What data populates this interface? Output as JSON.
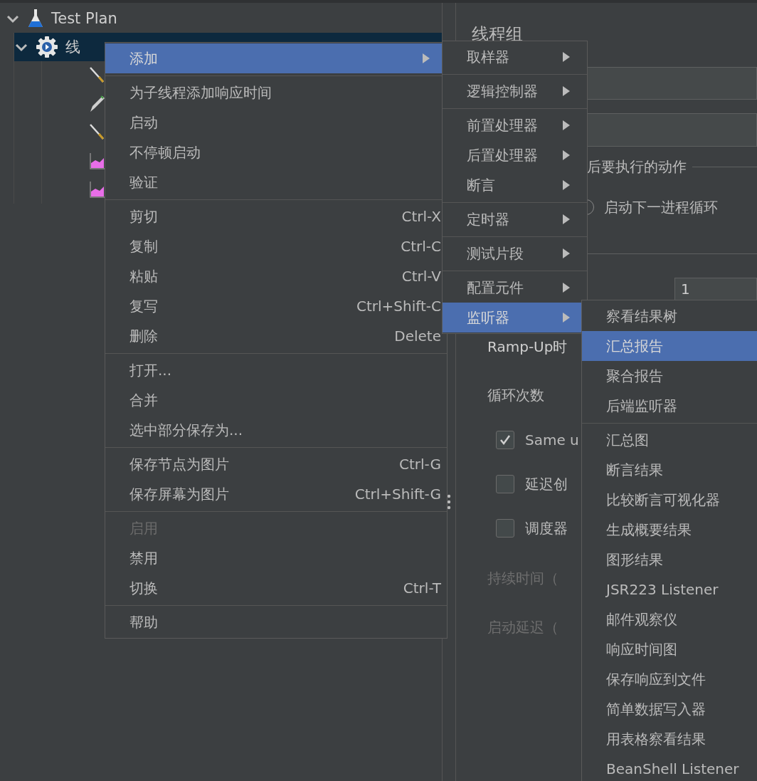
{
  "tree": [
    {
      "label": "Test Plan",
      "kind": "flask",
      "expanded": true,
      "selected": false,
      "children": [
        {
          "label": "线",
          "kind": "gear",
          "expanded": true,
          "selected": true,
          "children": [
            {
              "kind": "wand"
            },
            {
              "kind": "pencil"
            },
            {
              "kind": "wand"
            },
            {
              "kind": "chart"
            },
            {
              "kind": "chart"
            }
          ]
        }
      ]
    }
  ],
  "editor": {
    "title": "线程组",
    "group_label": "后要执行的动作",
    "radio": {
      "label": "启动下一进程循环",
      "selected": false
    },
    "thread_count": "1",
    "ramp_up_label": "Ramp-Up时",
    "loop_label": "循环次数",
    "checkboxes": [
      {
        "label": "Same u",
        "checked": true
      },
      {
        "label": "延迟创",
        "checked": false
      },
      {
        "label": "调度器",
        "checked": false
      }
    ],
    "disabled_labels": [
      "持续时间（",
      "启动延迟（"
    ]
  },
  "context_menu": {
    "groups": [
      [
        {
          "label": "添加",
          "submenu": true,
          "selected": true,
          "disabled": false
        }
      ],
      [
        {
          "label": "为子线程添加响应时间",
          "submenu": false,
          "selected": false,
          "disabled": false
        },
        {
          "label": "启动",
          "submenu": false,
          "selected": false,
          "disabled": false
        },
        {
          "label": "不停顿启动",
          "submenu": false,
          "selected": false,
          "disabled": false
        },
        {
          "label": "验证",
          "submenu": false,
          "selected": false,
          "disabled": false
        }
      ],
      [
        {
          "label": "剪切",
          "shortcut": "Ctrl-X",
          "submenu": false,
          "selected": false,
          "disabled": false
        },
        {
          "label": "复制",
          "shortcut": "Ctrl-C",
          "submenu": false,
          "selected": false,
          "disabled": false
        },
        {
          "label": "粘贴",
          "shortcut": "Ctrl-V",
          "submenu": false,
          "selected": false,
          "disabled": false
        },
        {
          "label": "复写",
          "shortcut": "Ctrl+Shift-C",
          "submenu": false,
          "selected": false,
          "disabled": false
        },
        {
          "label": "删除",
          "shortcut": "Delete",
          "submenu": false,
          "selected": false,
          "disabled": false
        }
      ],
      [
        {
          "label": "打开...",
          "submenu": false,
          "selected": false,
          "disabled": false
        },
        {
          "label": "合并",
          "submenu": false,
          "selected": false,
          "disabled": false
        },
        {
          "label": "选中部分保存为...",
          "submenu": false,
          "selected": false,
          "disabled": false
        }
      ],
      [
        {
          "label": "保存节点为图片",
          "shortcut": "Ctrl-G",
          "submenu": false,
          "selected": false,
          "disabled": false
        },
        {
          "label": "保存屏幕为图片",
          "shortcut": "Ctrl+Shift-G",
          "submenu": false,
          "selected": false,
          "disabled": false
        }
      ],
      [
        {
          "label": "启用",
          "submenu": false,
          "selected": false,
          "disabled": true
        },
        {
          "label": "禁用",
          "submenu": false,
          "selected": false,
          "disabled": false
        },
        {
          "label": "切换",
          "shortcut": "Ctrl-T",
          "submenu": false,
          "selected": false,
          "disabled": false
        }
      ],
      [
        {
          "label": "帮助",
          "submenu": false,
          "selected": false,
          "disabled": false
        }
      ]
    ]
  },
  "add_submenu": {
    "groups": [
      [
        {
          "label": "取样器",
          "submenu": true,
          "selected": false
        }
      ],
      [
        {
          "label": "逻辑控制器",
          "submenu": true,
          "selected": false
        }
      ],
      [
        {
          "label": "前置处理器",
          "submenu": true,
          "selected": false
        },
        {
          "label": "后置处理器",
          "submenu": true,
          "selected": false
        },
        {
          "label": "断言",
          "submenu": true,
          "selected": false
        }
      ],
      [
        {
          "label": "定时器",
          "submenu": true,
          "selected": false
        }
      ],
      [
        {
          "label": "测试片段",
          "submenu": true,
          "selected": false
        }
      ],
      [
        {
          "label": "配置元件",
          "submenu": true,
          "selected": false
        },
        {
          "label": "监听器",
          "submenu": true,
          "selected": true
        }
      ]
    ]
  },
  "listener_submenu": {
    "groups": [
      [
        {
          "label": "察看结果树",
          "selected": false
        },
        {
          "label": "汇总报告",
          "selected": true
        },
        {
          "label": "聚合报告",
          "selected": false
        },
        {
          "label": "后端监听器",
          "selected": false
        }
      ],
      [
        {
          "label": "汇总图",
          "selected": false
        },
        {
          "label": "断言结果",
          "selected": false
        },
        {
          "label": "比较断言可视化器",
          "selected": false
        },
        {
          "label": "生成概要结果",
          "selected": false
        },
        {
          "label": "图形结果",
          "selected": false
        },
        {
          "label": "JSR223 Listener",
          "selected": false
        },
        {
          "label": "邮件观察仪",
          "selected": false
        },
        {
          "label": "响应时间图",
          "selected": false
        },
        {
          "label": "保存响应到文件",
          "selected": false
        },
        {
          "label": "简单数据写入器",
          "selected": false
        },
        {
          "label": "用表格察看结果",
          "selected": false
        },
        {
          "label": "BeanShell Listener",
          "selected": false
        }
      ]
    ]
  }
}
